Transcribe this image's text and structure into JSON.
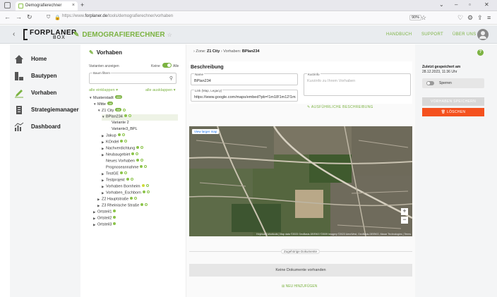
{
  "browser": {
    "tab_title": "Demografierechner",
    "url_prefix": "https://www.",
    "url_domain": "forplaner.de",
    "url_path": "/tools/demografierechner/vorhaben",
    "zoom": "90%"
  },
  "header": {
    "logo_main": "FORPLANER",
    "logo_sub": "BOX",
    "app_title": "DEMOGRAFIERECHNER",
    "links": [
      "HANDBUCH",
      "SUPPORT",
      "ÜBER UNS"
    ]
  },
  "leftnav": {
    "items": [
      {
        "label": "Home",
        "icon": "home-icon"
      },
      {
        "label": "Bautypen",
        "icon": "building-types-icon"
      },
      {
        "label": "Vorhaben",
        "icon": "pencil-icon"
      },
      {
        "label": "Strategiemanager",
        "icon": "strategy-icon"
      },
      {
        "label": "Dashboard",
        "icon": "dashboard-icon"
      }
    ]
  },
  "treepanel": {
    "title": "Vorhaben",
    "variants_label": "Varianten anzeigen",
    "toggle_left": "Keine",
    "toggle_right": "Alle",
    "search_legend": "Baum filtern",
    "collapse_all": "alle einklappen",
    "expand_all": "alle ausklappen",
    "nodes": [
      {
        "label": "Musterstadt",
        "badge": "400"
      },
      {
        "label": "Mitte",
        "badge": "18"
      },
      {
        "label": "Z1 City",
        "badge": "88"
      },
      {
        "label": "BPlan234"
      },
      {
        "label": "Variante 2"
      },
      {
        "label": "Variante3_BPL"
      },
      {
        "label": "Jakup"
      },
      {
        "label": "KOndel"
      },
      {
        "label": "Nachverdichtung"
      },
      {
        "label": "Neubaugebiet"
      },
      {
        "label": "Neues Vorhaben"
      },
      {
        "label": "Prognoseannahme"
      },
      {
        "label": "TestGE"
      },
      {
        "label": "Testprojekt"
      },
      {
        "label": "Vorhaben Bornheim"
      },
      {
        "label": "Vorhaben_Eschborn"
      },
      {
        "label": "Z2 Hauptstraße"
      },
      {
        "label": "Z3 Rheinische Straße"
      },
      {
        "label": "Ortsteil1"
      },
      {
        "label": "Ortsteil2"
      },
      {
        "label": "Ortsteil3"
      }
    ]
  },
  "main": {
    "crumb_zone_prefix": "Zone:",
    "crumb_zone": "Z1 City",
    "crumb_plan_prefix": "Vorhaben:",
    "crumb_plan": "BPlan234",
    "section_title": "Beschreibung",
    "name_legend": "Name",
    "name_value": "BPlan234",
    "short_legend": "Kurzinfo",
    "short_placeholder": "Kurzinfo zu Ihrem Vorhaben",
    "link_legend": "Link (Map, Legacy)",
    "link_value": "https://www.google.com/maps/embed?pb=!1m18!1m12!1m3!1c",
    "more_desc": "AUSFÜHRLICHE BESCHREIBUNG",
    "map_view_btn": "View larger map",
    "map_footer": "Keyboard shortcuts | Map data ©2023 GeoBasis-DE/BKG ©2009 Imagery ©2023 AeroWest, GeoBasis-DE/BKG, Maxar Technologies | Terms",
    "docs_label": "Zugehörige Dokumente",
    "docs_empty": "Keine Dokumente vorhanden",
    "docs_add": "NEU HINZUFÜGEN"
  },
  "rightpanel": {
    "saved_label": "Zuletzt gespeichert am",
    "saved_date": "28.12.2023, 11:36 Uhr",
    "lock_label": "Sperren",
    "save_btn": "VORHABEN SPEICHERN",
    "delete_btn": "LÖSCHEN"
  },
  "colors": {
    "accent": "#7cb342",
    "danger": "#f4511e"
  }
}
